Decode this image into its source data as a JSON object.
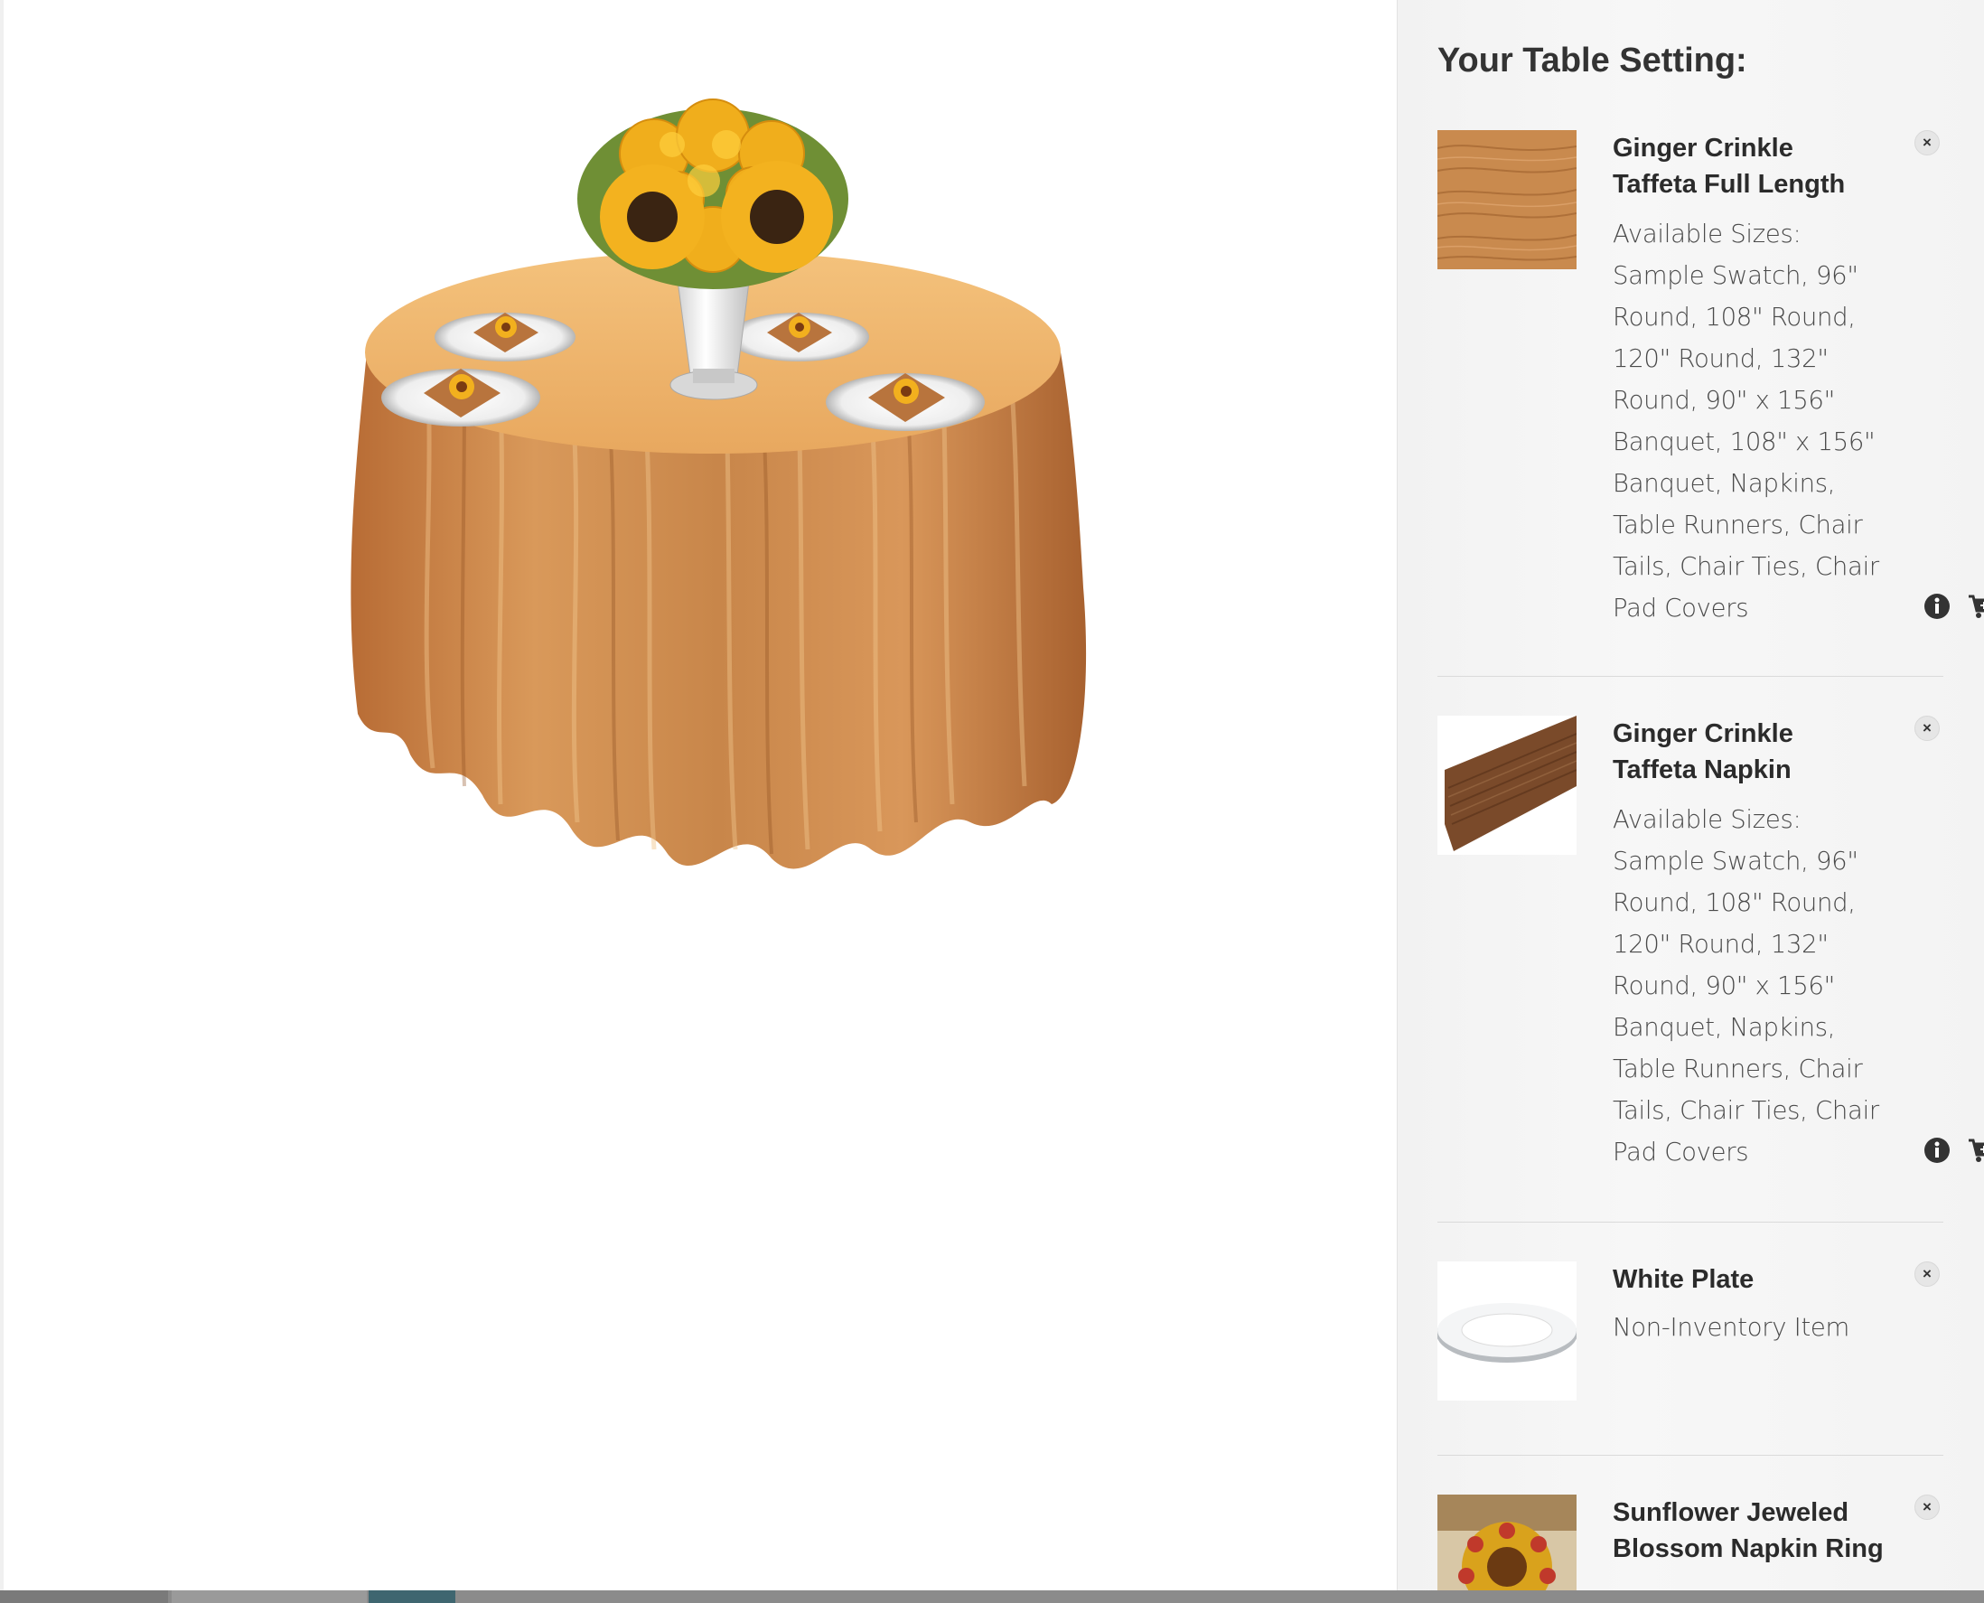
{
  "panel": {
    "title": "Your Table Setting:"
  },
  "items": [
    {
      "name": "Ginger Crinkle Taffeta Full Length",
      "desc_label": "Available Sizes:",
      "desc_lines": [
        "Sample Swatch, 96\"",
        "Round, 108\" Round,",
        "120\" Round, 132\"",
        "Round, 90\" x 156\"",
        "Banquet, 108\" x 156\"",
        "Banquet, Napkins,",
        "Table Runners, Chair",
        "Tails, Chair Ties, Chair",
        "Pad Covers"
      ],
      "remove_icon": "×",
      "thumb_icon": "taffeta-swatch"
    },
    {
      "name": "Ginger Crinkle Taffeta Napkin",
      "desc_label": "Available Sizes:",
      "desc_lines": [
        "Sample Swatch, 96\"",
        "Round, 108\" Round,",
        "120\" Round, 132\"",
        "Round, 90\" x 156\"",
        "Banquet, Napkins,",
        "Table Runners, Chair",
        "Tails, Chair Ties, Chair",
        "Pad Covers"
      ],
      "remove_icon": "×",
      "thumb_icon": "table-runner"
    },
    {
      "name": "White Plate",
      "desc_label": "Non-Inventory Item",
      "remove_icon": "×",
      "thumb_icon": "white-plate"
    },
    {
      "name": "Sunflower Jeweled Blossom Napkin Ring",
      "remove_icon": "×",
      "thumb_icon": "sunflower-napkin-ring"
    }
  ],
  "colors": {
    "taffeta": "#c98a4e",
    "runner": "#7a4a2a",
    "sunflower": "#f2b01e",
    "panel_bg": "#f5f5f5"
  }
}
